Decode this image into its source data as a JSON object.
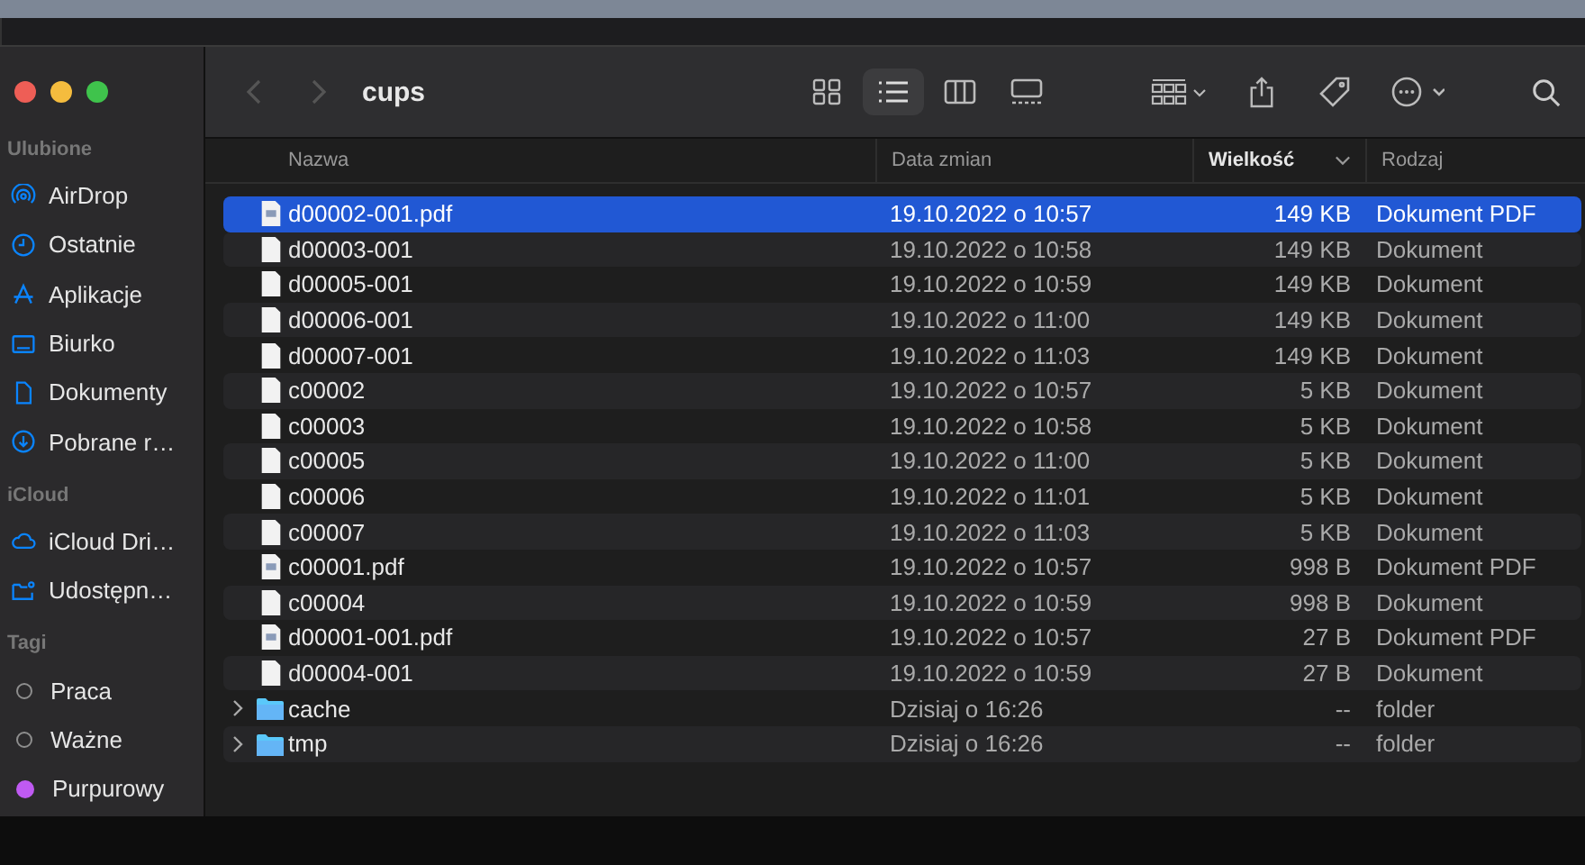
{
  "sidebar": {
    "sections": [
      {
        "title": "Ulubione",
        "items": [
          {
            "label": "AirDrop",
            "kind": "airdrop"
          },
          {
            "label": "Ostatnie",
            "kind": "clock"
          },
          {
            "label": "Aplikacje",
            "kind": "apps"
          },
          {
            "label": "Biurko",
            "kind": "desktop"
          },
          {
            "label": "Dokumenty",
            "kind": "document"
          },
          {
            "label": "Pobrane r…",
            "kind": "download"
          }
        ]
      },
      {
        "title": "iCloud",
        "items": [
          {
            "label": "iCloud Dri…",
            "kind": "cloud"
          },
          {
            "label": "Udostępn…",
            "kind": "shared"
          }
        ]
      },
      {
        "title": "Tagi",
        "items": [
          {
            "label": "Praca",
            "kind": "tag"
          },
          {
            "label": "Ważne",
            "kind": "tag"
          },
          {
            "label": "Purpurowy",
            "kind": "tag",
            "color": "#bf5af2"
          }
        ]
      }
    ]
  },
  "toolbar": {
    "title": "cups",
    "views": [
      {
        "kind": "icons",
        "selected": false
      },
      {
        "kind": "list",
        "selected": true
      },
      {
        "kind": "columns",
        "selected": false
      },
      {
        "kind": "gallery",
        "selected": false
      }
    ]
  },
  "table": {
    "columns": [
      {
        "label": "Nazwa",
        "sorted": false
      },
      {
        "label": "Data zmian",
        "sorted": false
      },
      {
        "label": "Wielkość",
        "sorted": true
      },
      {
        "label": "Rodzaj",
        "sorted": false
      }
    ],
    "rows": [
      {
        "name": "d00002-001.pdf",
        "date": "19.10.2022 o 10:57",
        "size": "149 KB",
        "type": "Dokument PDF",
        "kind": "pdf",
        "selected": true
      },
      {
        "name": "d00003-001",
        "date": "19.10.2022 o 10:58",
        "size": "149 KB",
        "type": "Dokument",
        "kind": "doc",
        "selected": false
      },
      {
        "name": "d00005-001",
        "date": "19.10.2022 o 10:59",
        "size": "149 KB",
        "type": "Dokument",
        "kind": "doc",
        "selected": false
      },
      {
        "name": "d00006-001",
        "date": "19.10.2022 o 11:00",
        "size": "149 KB",
        "type": "Dokument",
        "kind": "doc",
        "selected": false
      },
      {
        "name": "d00007-001",
        "date": "19.10.2022 o 11:03",
        "size": "149 KB",
        "type": "Dokument",
        "kind": "doc",
        "selected": false
      },
      {
        "name": "c00002",
        "date": "19.10.2022 o 10:57",
        "size": "5 KB",
        "type": "Dokument",
        "kind": "doc",
        "selected": false
      },
      {
        "name": "c00003",
        "date": "19.10.2022 o 10:58",
        "size": "5 KB",
        "type": "Dokument",
        "kind": "doc",
        "selected": false
      },
      {
        "name": "c00005",
        "date": "19.10.2022 o 11:00",
        "size": "5 KB",
        "type": "Dokument",
        "kind": "doc",
        "selected": false
      },
      {
        "name": "c00006",
        "date": "19.10.2022 o 11:01",
        "size": "5 KB",
        "type": "Dokument",
        "kind": "doc",
        "selected": false
      },
      {
        "name": "c00007",
        "date": "19.10.2022 o 11:03",
        "size": "5 KB",
        "type": "Dokument",
        "kind": "doc",
        "selected": false
      },
      {
        "name": "c00001.pdf",
        "date": "19.10.2022 o 10:57",
        "size": "998 B",
        "type": "Dokument PDF",
        "kind": "pdf",
        "selected": false
      },
      {
        "name": "c00004",
        "date": "19.10.2022 o 10:59",
        "size": "998 B",
        "type": "Dokument",
        "kind": "doc",
        "selected": false
      },
      {
        "name": "d00001-001.pdf",
        "date": "19.10.2022 o 10:57",
        "size": "27 B",
        "type": "Dokument PDF",
        "kind": "pdf",
        "selected": false
      },
      {
        "name": "d00004-001",
        "date": "19.10.2022 o 10:59",
        "size": "27 B",
        "type": "Dokument",
        "kind": "doc",
        "selected": false
      },
      {
        "name": "cache",
        "date": "Dzisiaj o 16:26",
        "size": "--",
        "type": "folder",
        "kind": "folder",
        "selected": false
      },
      {
        "name": "tmp",
        "date": "Dzisiaj o 16:26",
        "size": "--",
        "type": "folder",
        "kind": "folder",
        "selected": false
      }
    ]
  }
}
